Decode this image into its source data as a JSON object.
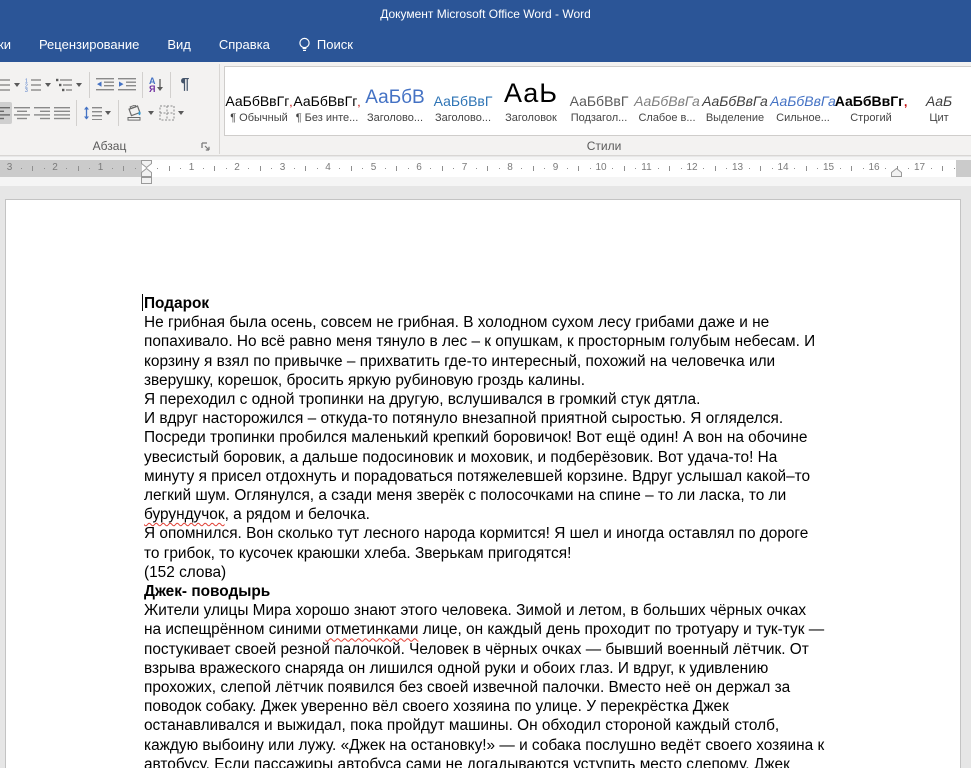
{
  "titlebar": {
    "title": "Документ Microsoft Office Word  -  Word"
  },
  "tabs": {
    "items": [
      {
        "label": "ки"
      },
      {
        "label": "Рецензирование"
      },
      {
        "label": "Вид"
      },
      {
        "label": "Справка"
      }
    ],
    "search_label": "Поиск"
  },
  "ribbon": {
    "paragraph_group": {
      "label": "Абзац",
      "sort_icon_top": "А",
      "sort_icon_bottom": "Я",
      "pilcrow": "¶"
    },
    "styles_group": {
      "label": "Стили",
      "items": [
        {
          "preview": "АаБбВвГг",
          "red_mark": ",",
          "label": "¶ Обычный",
          "variant": "normal"
        },
        {
          "preview": "АаБбВвГг",
          "red_mark": ",",
          "label": "¶ Без инте...",
          "variant": "normal"
        },
        {
          "preview": "АаБбВ",
          "red_mark": "",
          "label": "Заголово...",
          "variant": "h1"
        },
        {
          "preview": "АаБбВвГ",
          "red_mark": "",
          "label": "Заголово...",
          "variant": "h2"
        },
        {
          "preview": "АаЬ",
          "red_mark": "",
          "label": "Заголовок",
          "variant": "title"
        },
        {
          "preview": "АаБбВвГ",
          "red_mark": "",
          "label": "Подзагол...",
          "variant": "subtitle"
        },
        {
          "preview": "АаБбВвГа",
          "red_mark": "",
          "label": "Слабое в...",
          "variant": "subtle"
        },
        {
          "preview": "АаБбВвГа",
          "red_mark": "",
          "label": "Выделение",
          "variant": "emphasis"
        },
        {
          "preview": "АаБбВвГа",
          "red_mark": "",
          "label": "Сильное...",
          "variant": "intense"
        },
        {
          "preview": "АаБбВвГг",
          "red_mark": ",",
          "label": "Строгий",
          "variant": "strong"
        },
        {
          "preview": "АаБ",
          "red_mark": "",
          "label": "Цит",
          "variant": "quote"
        }
      ]
    }
  },
  "ruler": {
    "left_numbers": [
      "1",
      "2",
      "3"
    ],
    "numbers": [
      "1",
      "2",
      "3",
      "4",
      "5",
      "6",
      "7",
      "8",
      "9",
      "10",
      "11",
      "12",
      "13",
      "14",
      "15",
      "16",
      "17"
    ]
  },
  "document": {
    "lines": [
      {
        "segments": [
          {
            "text": "Подарок",
            "style": "bold"
          }
        ]
      },
      {
        "segments": [
          {
            "text": "Не грибная была осень, совсем не грибная. В холодном сухом лесу грибами даже и не",
            "style": "normal"
          }
        ]
      },
      {
        "segments": [
          {
            "text": "попахивало. Но всё равно меня тянуло в лес – к опушкам, к просторным голубым небесам. И",
            "style": "normal"
          }
        ]
      },
      {
        "segments": [
          {
            "text": "корзину я взял по привычке – прихватить где-то интересный, похожий на человечка или",
            "style": "normal"
          }
        ]
      },
      {
        "segments": [
          {
            "text": "зверушку, корешок, бросить яркую рубиновую гроздь калины.",
            "style": "normal"
          }
        ]
      },
      {
        "segments": [
          {
            "text": "Я переходил с одной тропинки на другую, вслушивался в громкий стук дятла.",
            "style": "normal"
          }
        ]
      },
      {
        "segments": [
          {
            "text": "И вдруг насторожился – откуда-то потянуло внезапной приятной сыростью. Я огляделся.",
            "style": "normal"
          }
        ]
      },
      {
        "segments": [
          {
            "text": "Посреди тропинки пробился маленький крепкий боровичок! Вот ещё один! А вон на обочине",
            "style": "normal"
          }
        ]
      },
      {
        "segments": [
          {
            "text": "увесистый боровик, а дальше подосиновик и моховик, и подберёзовик. Вот удача-то! На",
            "style": "normal"
          }
        ]
      },
      {
        "segments": [
          {
            "text": "минуту я присел отдохнуть и порадоваться потяжелевшей корзине. Вдруг услышал какой–то",
            "style": "normal"
          }
        ]
      },
      {
        "segments": [
          {
            "text": "легкий шум. Оглянулся, а сзади меня зверёк с полосочками на спине – то ли ласка, то ли",
            "style": "normal"
          }
        ]
      },
      {
        "segments": [
          {
            "text": "бурундучок",
            "style": "misspelled"
          },
          {
            "text": ", а рядом и белочка.",
            "style": "normal"
          }
        ]
      },
      {
        "segments": [
          {
            "text": "Я опомнился. Вон сколько тут лесного народа кормится! Я шел и иногда оставлял по дороге",
            "style": "normal"
          }
        ]
      },
      {
        "segments": [
          {
            "text": "то грибок, то кусочек краюшки хлеба. Зверькам пригодятся!",
            "style": "normal"
          }
        ]
      },
      {
        "segments": [
          {
            "text": "(152 слова)",
            "style": "normal"
          }
        ]
      },
      {
        "segments": [
          {
            "text": "Джек- поводырь",
            "style": "bold"
          }
        ]
      },
      {
        "segments": [
          {
            "text": "Жители улицы Мира хорошо знают этого человека. Зимой и летом, в больших чёрных очках",
            "style": "normal"
          }
        ]
      },
      {
        "segments": [
          {
            "text": "на испещрённом синими ",
            "style": "normal"
          },
          {
            "text": "отметинками",
            "style": "misspelled"
          },
          {
            "text": " лице, он каждый день проходит по тротуару и тук-тук —",
            "style": "normal"
          }
        ]
      },
      {
        "segments": [
          {
            "text": "постукивает своей резной палочкой. Человек в чёрных очках — бывший военный лётчик. От",
            "style": "normal"
          }
        ]
      },
      {
        "segments": [
          {
            "text": "взрыва вражеского снаряда он лишился одной руки и обоих глаз. И вдруг, к удивлению",
            "style": "normal"
          }
        ]
      },
      {
        "segments": [
          {
            "text": "прохожих, слепой лётчик появился без своей извечной палочки. Вместо неё он держал за",
            "style": "normal"
          }
        ]
      },
      {
        "segments": [
          {
            "text": "поводок собаку. Джек уверенно вёл своего хозяина по улице. У перекрёстка Джек",
            "style": "normal"
          }
        ]
      },
      {
        "segments": [
          {
            "text": "останавливался и выжидал, пока пройдут машины. Он обходил стороной каждый столб,",
            "style": "normal"
          }
        ]
      },
      {
        "segments": [
          {
            "text": "каждую выбоину или лужу. «Джек на остановку!» — и собака послушно ведёт своего хозяина к",
            "style": "normal"
          }
        ]
      },
      {
        "segments": [
          {
            "text": "автобусу. Если пассажиры автобуса сами не догадываются уступить место слепому, Джек",
            "style": "normal"
          }
        ]
      }
    ]
  },
  "colors": {
    "titlebar_blue": "#2b5597",
    "heading_blue": "#4472c4",
    "heading2_blue": "#2e74b5",
    "misspell_red": "#e03c31",
    "style_red_mark": "#c00000"
  }
}
